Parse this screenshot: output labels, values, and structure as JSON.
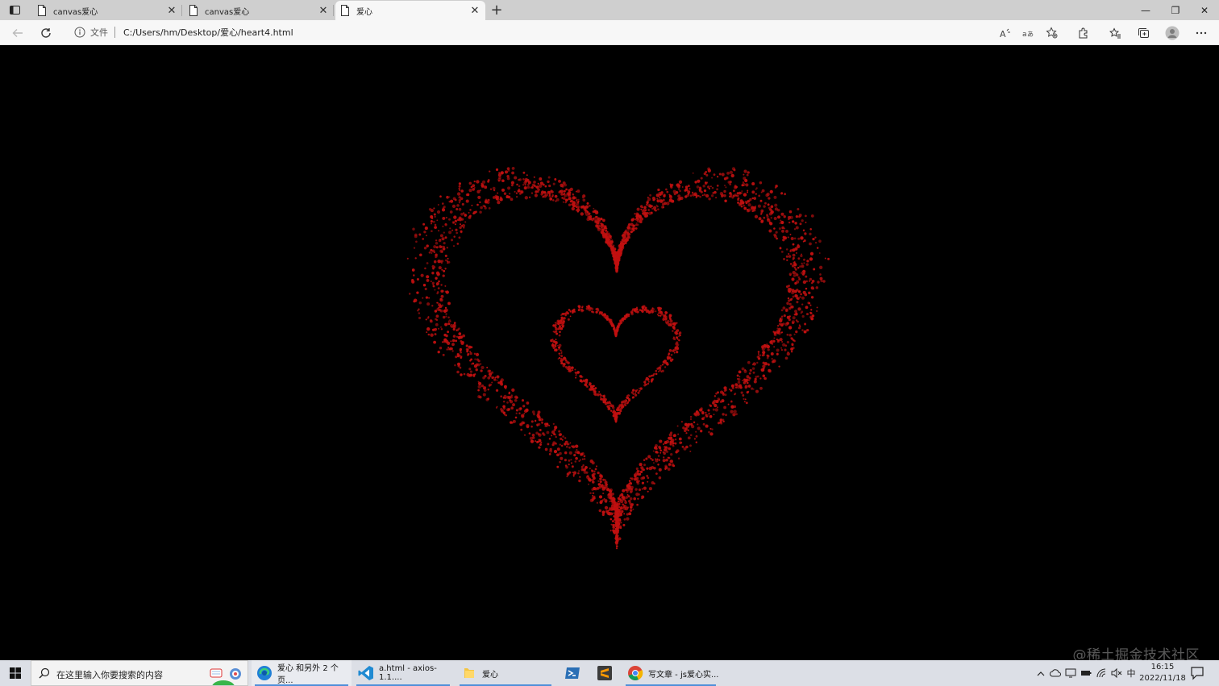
{
  "browser": {
    "tabs": [
      {
        "title": "canvas爱心",
        "active": false
      },
      {
        "title": "canvas爱心",
        "active": false
      },
      {
        "title": "爱心",
        "active": true
      }
    ],
    "new_tab_label": "+",
    "window_controls": {
      "minimize": "—",
      "restore": "❐",
      "close": "✕"
    }
  },
  "toolbar": {
    "scheme_label": "文件",
    "url": "C:/Users/hm/Desktop/爱心/heart4.html"
  },
  "content": {
    "background": "#000000",
    "heart_color": "#c01010",
    "watermark": "@稀土掘金技术社区"
  },
  "taskbar": {
    "search_placeholder": "在这里输入你要搜索的内容",
    "apps": [
      {
        "label": "爱心 和另外 2 个页...",
        "icon": "edge-icon"
      },
      {
        "label": "a.html - axios-1.1....",
        "icon": "vscode-icon"
      },
      {
        "label": "爱心",
        "icon": "folder-icon"
      },
      {
        "label": "",
        "icon": "powershell-icon"
      },
      {
        "label": "",
        "icon": "sublime-icon"
      },
      {
        "label": "写文章 - js爱心实...",
        "icon": "chrome-icon"
      }
    ],
    "tray": {
      "ime": "中"
    },
    "clock": {
      "time": "16:15",
      "date": "2022/11/18"
    }
  }
}
